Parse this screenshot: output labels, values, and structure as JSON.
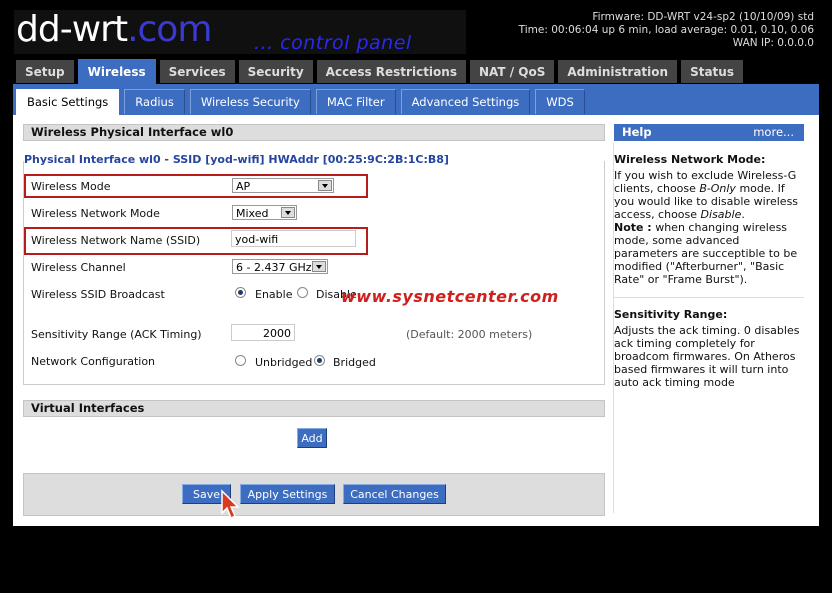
{
  "header": {
    "brand_main": "dd-wrt",
    "brand_suffix": ".com",
    "tagline": "... control panel",
    "firmware": "Firmware: DD-WRT v24-sp2 (10/10/09) std",
    "time": "Time: 00:06:04 up 6 min, load average: 0.01, 0.10, 0.06",
    "wan_ip": "WAN IP: 0.0.0.0"
  },
  "main_tabs": [
    "Setup",
    "Wireless",
    "Services",
    "Security",
    "Access Restrictions",
    "NAT / QoS",
    "Administration",
    "Status"
  ],
  "sub_tabs": [
    "Basic Settings",
    "Radius",
    "Wireless Security",
    "MAC Filter",
    "Advanced Settings",
    "WDS"
  ],
  "physical": {
    "section_title": "Wireless Physical Interface wl0",
    "legend": "Physical Interface wl0 - SSID [yod-wifi] HWAddr [00:25:9C:2B:1C:B8]",
    "wireless_mode_label": "Wireless Mode",
    "wireless_mode_value": "AP",
    "network_mode_label": "Wireless Network Mode",
    "network_mode_value": "Mixed",
    "ssid_label": "Wireless Network Name (SSID)",
    "ssid_value": "yod-wifi",
    "channel_label": "Wireless Channel",
    "channel_value": "6 - 2.437 GHz",
    "broadcast_label": "Wireless SSID Broadcast",
    "broadcast_enable": "Enable",
    "broadcast_disable": "Disable",
    "sensitivity_label": "Sensitivity Range (ACK Timing)",
    "sensitivity_value": "2000",
    "sensitivity_default": "(Default: 2000 meters)",
    "netconfig_label": "Network Configuration",
    "unbridged": "Unbridged",
    "bridged": "Bridged"
  },
  "virtual": {
    "section_title": "Virtual Interfaces",
    "add_label": "Add"
  },
  "actions": {
    "save": "Save",
    "apply": "Apply Settings",
    "cancel": "Cancel Changes"
  },
  "watermark": "www.sysnetcenter.com",
  "help": {
    "title": "Help",
    "more": "more...",
    "mode_title": "Wireless Network Mode:",
    "mode_text_1": "If you wish to exclude Wireless-G clients, choose",
    "mode_text_bonly": "B-Only",
    "mode_text_2": "mode. If you would like to disable wireless access, choose",
    "mode_text_disable": "Disable",
    "mode_text_3": ".",
    "note_label": "Note :",
    "note_text": "when changing wireless mode, some advanced parameters are succeptible to be modified (\"Afterburner\", \"Basic Rate\" or \"Frame Burst\").",
    "sens_title": "Sensitivity Range:",
    "sens_text": "Adjusts the ack timing. 0 disables ack timing completely for broadcom firmwares. On Atheros based firmwares it will turn into auto ack timing mode"
  },
  "colors": {
    "accent": "#3d6dc1",
    "highlight": "#b71c1c",
    "watermark": "#d0201e"
  }
}
